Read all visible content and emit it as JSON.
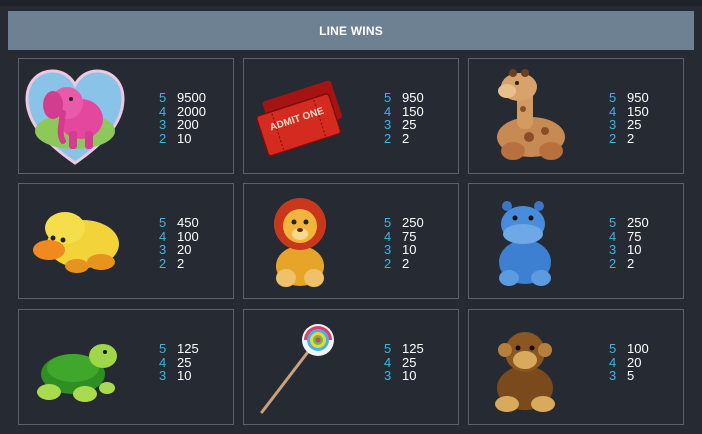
{
  "header": {
    "title": "LINE WINS"
  },
  "symbols": [
    {
      "icon": "heart-elephant-icon",
      "pays": [
        {
          "count": "5",
          "value": "9500"
        },
        {
          "count": "4",
          "value": "2000"
        },
        {
          "count": "3",
          "value": "200"
        },
        {
          "count": "2",
          "value": "10"
        }
      ]
    },
    {
      "icon": "admit-one-ticket-icon",
      "ticket_text": "ADMIT ONE",
      "pays": [
        {
          "count": "5",
          "value": "950"
        },
        {
          "count": "4",
          "value": "150"
        },
        {
          "count": "3",
          "value": "25"
        },
        {
          "count": "2",
          "value": "2"
        }
      ]
    },
    {
      "icon": "giraffe-plush-icon",
      "pays": [
        {
          "count": "5",
          "value": "950"
        },
        {
          "count": "4",
          "value": "150"
        },
        {
          "count": "3",
          "value": "25"
        },
        {
          "count": "2",
          "value": "2"
        }
      ]
    },
    {
      "icon": "duck-plush-icon",
      "pays": [
        {
          "count": "5",
          "value": "450"
        },
        {
          "count": "4",
          "value": "100"
        },
        {
          "count": "3",
          "value": "20"
        },
        {
          "count": "2",
          "value": "2"
        }
      ]
    },
    {
      "icon": "lion-plush-icon",
      "pays": [
        {
          "count": "5",
          "value": "250"
        },
        {
          "count": "4",
          "value": "75"
        },
        {
          "count": "3",
          "value": "10"
        },
        {
          "count": "2",
          "value": "2"
        }
      ]
    },
    {
      "icon": "hippo-plush-icon",
      "pays": [
        {
          "count": "5",
          "value": "250"
        },
        {
          "count": "4",
          "value": "75"
        },
        {
          "count": "3",
          "value": "10"
        },
        {
          "count": "2",
          "value": "2"
        }
      ]
    },
    {
      "icon": "turtle-plush-icon",
      "pays": [
        {
          "count": "5",
          "value": "125"
        },
        {
          "count": "4",
          "value": "25"
        },
        {
          "count": "3",
          "value": "10"
        }
      ]
    },
    {
      "icon": "lollipop-icon",
      "pays": [
        {
          "count": "5",
          "value": "125"
        },
        {
          "count": "4",
          "value": "25"
        },
        {
          "count": "3",
          "value": "10"
        }
      ]
    },
    {
      "icon": "monkey-plush-icon",
      "pays": [
        {
          "count": "5",
          "value": "100"
        },
        {
          "count": "4",
          "value": "20"
        },
        {
          "count": "3",
          "value": "5"
        }
      ]
    }
  ],
  "colors": {
    "header_bg": "#6e8193",
    "count_text": "#37b7e8",
    "value_text": "#ffffff",
    "panel_border": "#59626e"
  }
}
